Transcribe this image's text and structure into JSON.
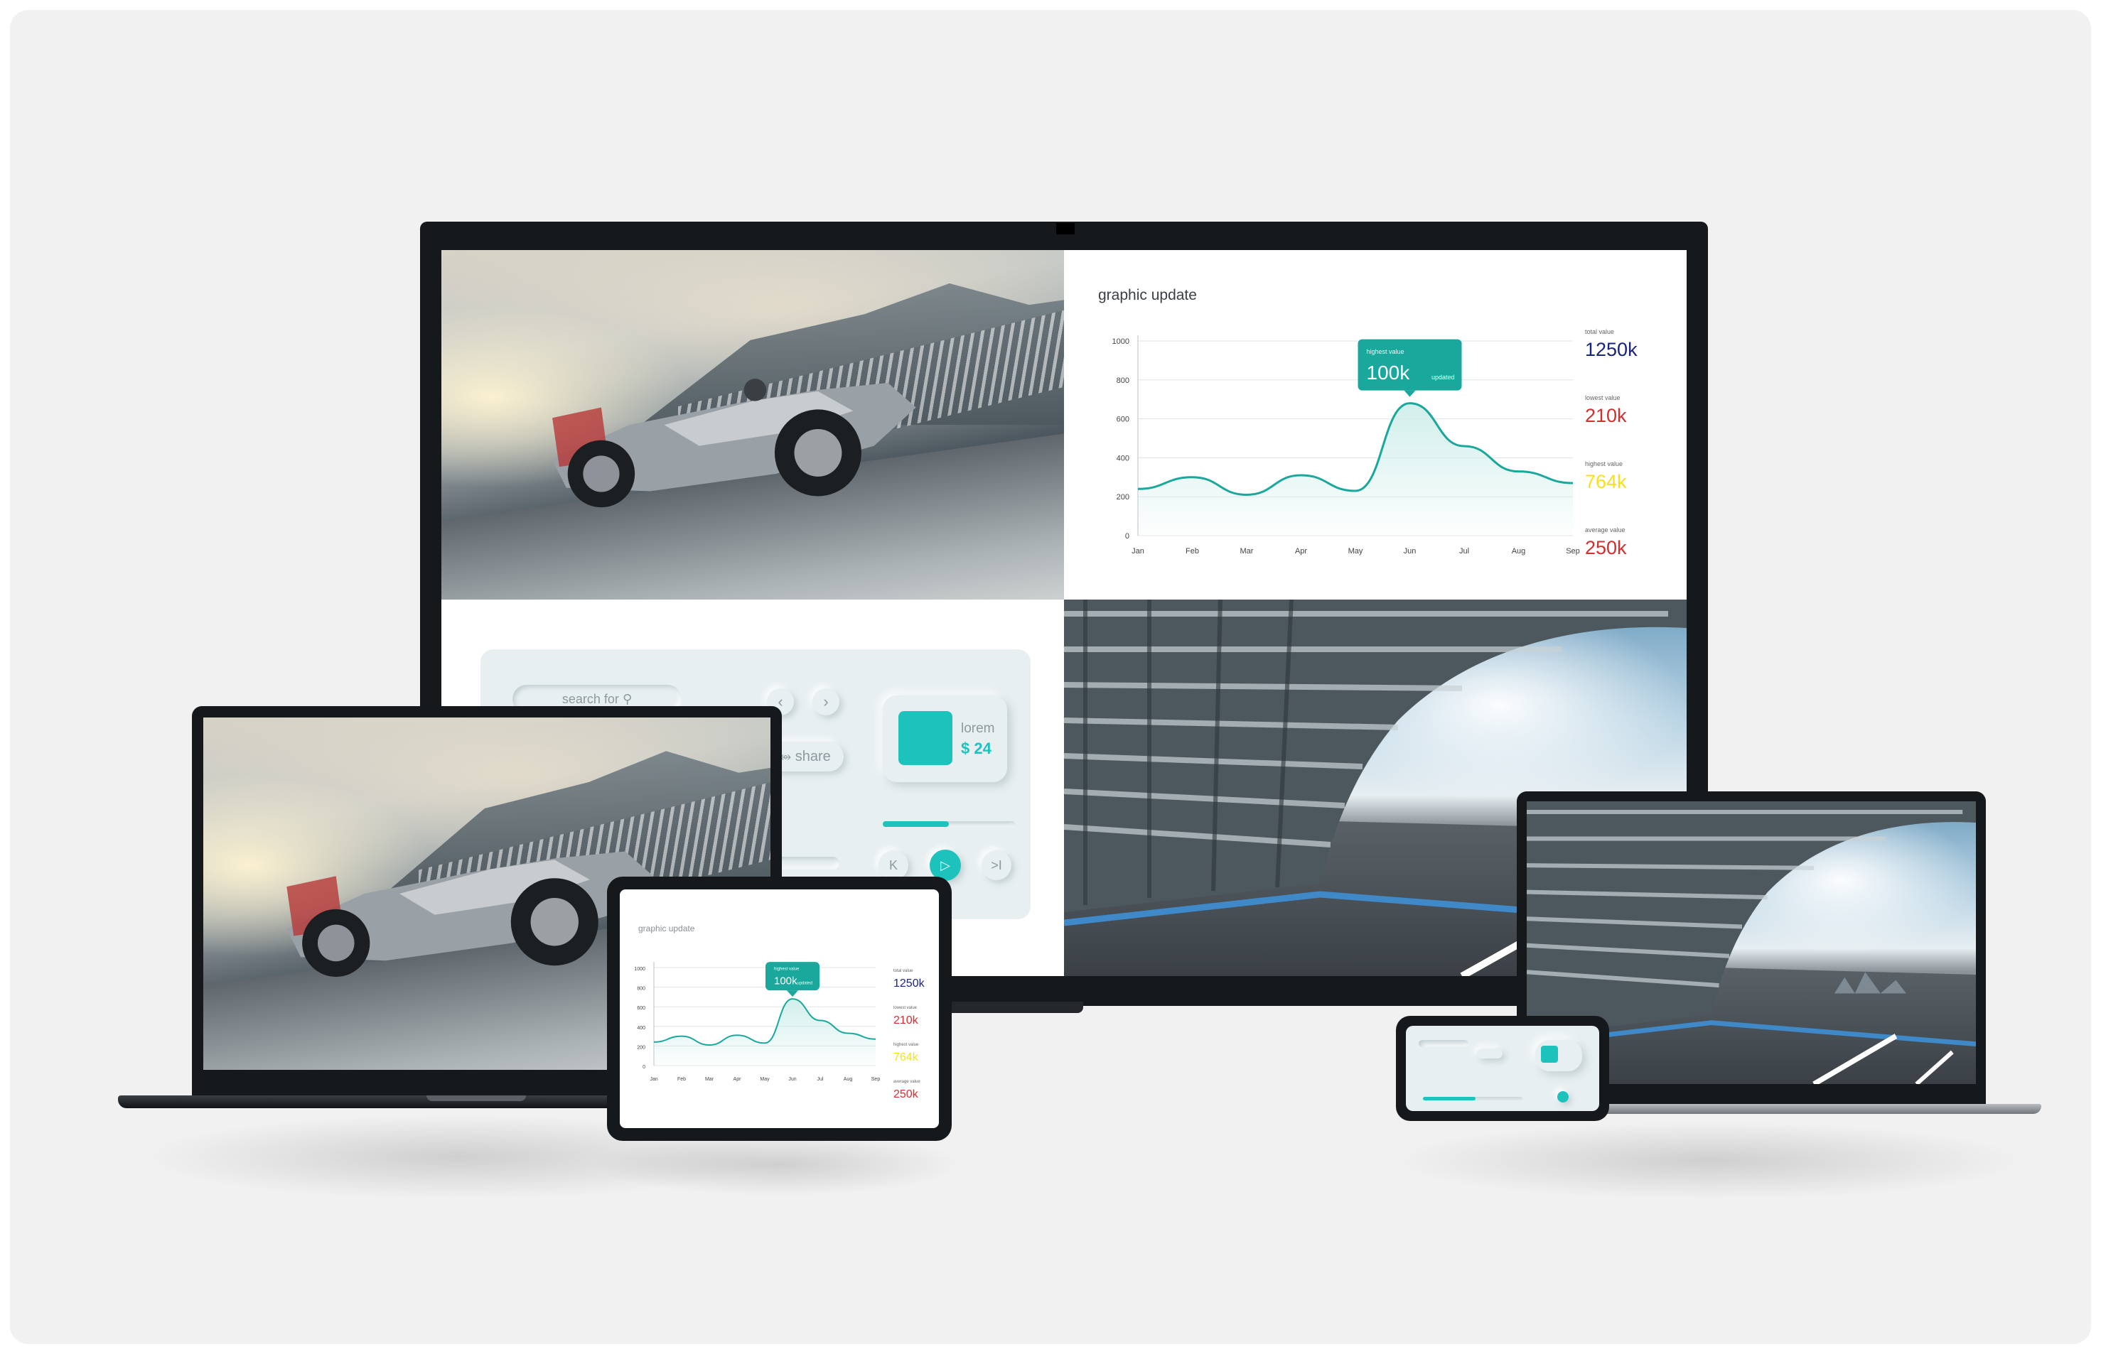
{
  "dashboard": {
    "title": "graphic update",
    "y_axis_ticks": [
      "1000",
      "800",
      "600",
      "400",
      "200",
      "0"
    ],
    "x_axis_ticks": [
      "Jan",
      "Feb",
      "Mar",
      "Apr",
      "May",
      "Jun",
      "Jul",
      "Aug",
      "Sep"
    ],
    "tooltip": {
      "label": "highest value",
      "value": "100k",
      "suffix": "updated"
    },
    "stats": [
      {
        "label": "total value",
        "value": "1250k",
        "color": "#1a237e"
      },
      {
        "label": "lowest value",
        "value": "210k",
        "color": "#d32f2f"
      },
      {
        "label": "highest value",
        "value": "764k",
        "color": "#f5e11b"
      },
      {
        "label": "average value",
        "value": "250k",
        "color": "#d32f2f"
      }
    ],
    "colors": {
      "line": "#1aa79c",
      "fill": "#cfeeea",
      "tooltip": "#1aa79c",
      "grid": "#dfe3ea"
    }
  },
  "chart_data": {
    "type": "area",
    "title": "graphic update",
    "x": [
      "Jan",
      "Feb",
      "Mar",
      "Apr",
      "May",
      "Jun",
      "Jul",
      "Aug",
      "Sep"
    ],
    "values": [
      240,
      300,
      210,
      310,
      230,
      680,
      460,
      330,
      270
    ],
    "ylim": [
      0,
      1000
    ],
    "grid": true,
    "legend": "none"
  },
  "player_panel": {
    "search_label": "search for",
    "share_label": "share",
    "product": {
      "name": "lorem",
      "price": "$ 24"
    },
    "progress": 0.5,
    "icons": {
      "search": "search-icon",
      "prev": "chevron-left-icon",
      "next": "chevron-right-icon",
      "share": "share-icon",
      "skip_back": "skip-back-icon",
      "play": "play-icon",
      "skip_forward": "skip-forward-icon"
    },
    "colors": {
      "accent": "#1ec2bd",
      "surface": "#e8eff1"
    }
  }
}
